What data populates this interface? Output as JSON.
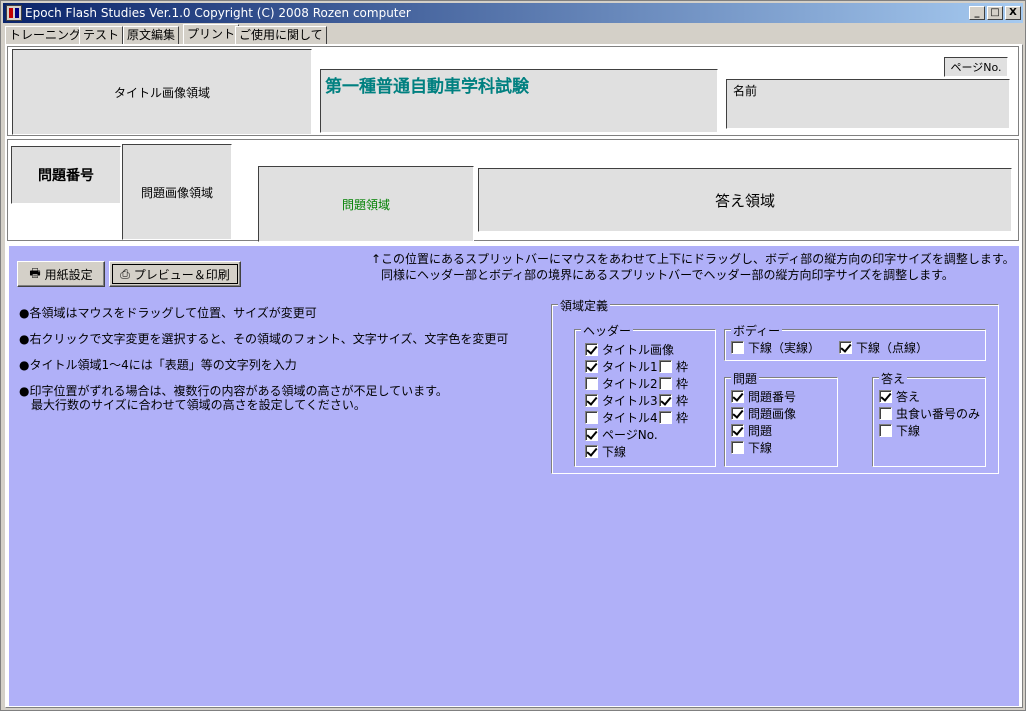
{
  "window": {
    "title": "Epoch Flash Studies Ver.1.0   Copyright (C) 2008 Rozen computer",
    "controls": {
      "minimize": "_",
      "maximize": "□",
      "close": "X"
    }
  },
  "tabs": [
    {
      "label": "トレーニング",
      "active": false
    },
    {
      "label": "テスト",
      "active": false
    },
    {
      "label": "原文編集",
      "active": false
    },
    {
      "label": "プリント",
      "active": true
    },
    {
      "label": "ご使用に関して",
      "active": false
    }
  ],
  "header": {
    "title_image_area": "タイトル画像領域",
    "title_text": "第一種普通自動車学科試験",
    "page_no": "ページNo.",
    "name_label": "名前"
  },
  "body": {
    "question_number": "問題番号",
    "question_image_area": "問題画像領域",
    "question_area": "問題領域",
    "answer_area": "答え領域"
  },
  "settings": {
    "paper_button": "用紙設定",
    "preview_button": "プレビュー＆印刷",
    "splitter_note_1": "↑この位置にあるスプリットバーにマウスをあわせて上下にドラッグし、ボディ部の縦方向の印字サイズを調整します。",
    "splitter_note_2": "同様にヘッダー部とボディ部の境界にあるスプリットバーでヘッダー部の縦方向印字サイズを調整します。",
    "notes": [
      "●各領域はマウスをドラッグして位置、サイズが変更可",
      "●右クリックで文字変更を選択すると、その領域のフォント、文字サイズ、文字色を変更可",
      "●タイトル領域1～4には「表題」等の文字列を入力",
      "●印字位置がずれる場合は、複数行の内容がある領域の高さが不足しています。",
      "　最大行数のサイズに合わせて領域の高さを設定してください。"
    ],
    "region_def": {
      "legend": "領域定義",
      "header_group": {
        "legend": "ヘッダー",
        "items": [
          {
            "label": "タイトル画像",
            "checked": true
          },
          {
            "label": "タイトル1",
            "checked": true,
            "frame_label": "枠",
            "frame_checked": false
          },
          {
            "label": "タイトル2",
            "checked": false,
            "frame_label": "枠",
            "frame_checked": false
          },
          {
            "label": "タイトル3",
            "checked": true,
            "frame_label": "枠",
            "frame_checked": true
          },
          {
            "label": "タイトル4",
            "checked": false,
            "frame_label": "枠",
            "frame_checked": false
          },
          {
            "label": "ページNo.",
            "checked": true
          },
          {
            "label": "下線",
            "checked": true
          }
        ]
      },
      "body_group": {
        "legend": "ボディー",
        "items": [
          {
            "label": "下線（実線）",
            "checked": false
          },
          {
            "label": "下線（点線）",
            "checked": true
          }
        ]
      },
      "question_group": {
        "legend": "問題",
        "items": [
          {
            "label": "問題番号",
            "checked": true
          },
          {
            "label": "問題画像",
            "checked": true
          },
          {
            "label": "問題",
            "checked": true
          },
          {
            "label": "下線",
            "checked": false
          }
        ]
      },
      "answer_group": {
        "legend": "答え",
        "items": [
          {
            "label": "答え",
            "checked": true
          },
          {
            "label": "虫食い番号のみ",
            "checked": false
          },
          {
            "label": "下線",
            "checked": false
          }
        ]
      }
    }
  },
  "colors": {
    "titlebar_start": "#0a246a",
    "titlebar_end": "#a6caf0",
    "settings_bg": "#b0b0f8",
    "title_text": "#008080",
    "question_area_text": "#008000"
  }
}
